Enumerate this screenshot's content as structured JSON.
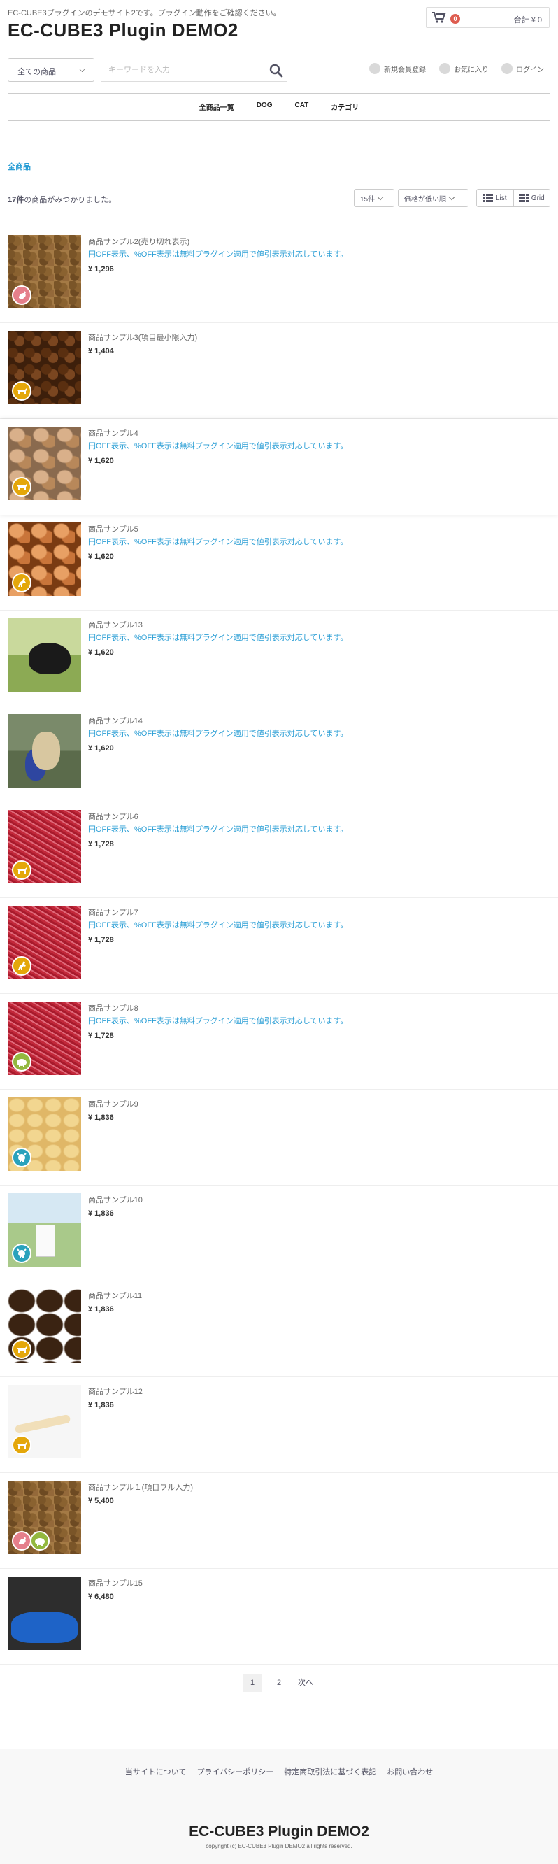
{
  "header": {
    "tagline": "EC-CUBE3プラグインのデモサイト2です。プラグイン動作をご確認ください。",
    "site_title": "EC-CUBE3 Plugin DEMO2",
    "cart": {
      "count": "0",
      "summary": "合計 ¥ 0"
    }
  },
  "search": {
    "category_value": "全ての商品",
    "placeholder": "キーワードを入力"
  },
  "user_nav": {
    "register": "新規会員登録",
    "favorites": "お気に入り",
    "login": "ログイン"
  },
  "category_nav": [
    "全商品一覧",
    "DOG",
    "CAT",
    "カテゴリ"
  ],
  "breadcrumb": "全商品",
  "results": {
    "count": "17件",
    "suffix": "の商品がみつかりました。"
  },
  "controls": {
    "per_page": "15件",
    "sort": "価格が低い順",
    "list_label": "List",
    "grid_label": "Grid"
  },
  "discount_note": "円OFF表示、%OFF表示は無料プラグイン適用で値引表示対応しています。",
  "products": [
    {
      "name": "商品サンプル2(売り切れ表示)",
      "price": "¥ 1,296",
      "note": true,
      "img": "kibble",
      "badges": [
        "chicken-icon"
      ],
      "badge_colors": [
        "#e57f8b"
      ]
    },
    {
      "name": "商品サンプル3(項目最小限入力)",
      "price": "¥ 1,404",
      "note": false,
      "img": "brownkib",
      "badges": [
        "cow-icon"
      ],
      "badge_colors": [
        "#e4a70a"
      ]
    },
    {
      "name": "商品サンプル4",
      "price": "¥ 1,620",
      "note": true,
      "img": "treats",
      "badges": [
        "cow-icon"
      ],
      "badge_colors": [
        "#e4a70a"
      ]
    },
    {
      "name": "商品サンプル5",
      "price": "¥ 1,620",
      "note": true,
      "img": "treats2",
      "badges": [
        "horse-icon"
      ],
      "badge_colors": [
        "#e4a70a"
      ]
    },
    {
      "name": "商品サンプル13",
      "price": "¥ 1,620",
      "note": true,
      "img": "dog1",
      "badges": [],
      "badge_colors": []
    },
    {
      "name": "商品サンプル14",
      "price": "¥ 1,620",
      "note": true,
      "img": "dog2",
      "badges": [],
      "badge_colors": []
    },
    {
      "name": "商品サンプル6",
      "price": "¥ 1,728",
      "note": true,
      "img": "mince",
      "badges": [
        "cow-icon"
      ],
      "badge_colors": [
        "#e4a70a"
      ]
    },
    {
      "name": "商品サンプル7",
      "price": "¥ 1,728",
      "note": true,
      "img": "mince",
      "badges": [
        "horse-icon"
      ],
      "badge_colors": [
        "#e4a70a"
      ]
    },
    {
      "name": "商品サンプル8",
      "price": "¥ 1,728",
      "note": true,
      "img": "mince",
      "badges": [
        "pig-icon"
      ],
      "badge_colors": [
        "#93b83f"
      ]
    },
    {
      "name": "商品サンプル9",
      "price": "¥ 1,836",
      "note": false,
      "img": "cheese",
      "badges": [
        "sheep-icon"
      ],
      "badge_colors": [
        "#2aa2bc"
      ]
    },
    {
      "name": "商品サンプル10",
      "price": "¥ 1,836",
      "note": false,
      "img": "milk",
      "badges": [
        "sheep-icon"
      ],
      "badge_colors": [
        "#2aa2bc"
      ]
    },
    {
      "name": "商品サンプル11",
      "price": "¥ 1,836",
      "note": false,
      "img": "jerky",
      "badges": [
        "cow-icon"
      ],
      "badge_colors": [
        "#e4a70a"
      ]
    },
    {
      "name": "商品サンプル12",
      "price": "¥ 1,836",
      "note": false,
      "img": "bone",
      "badges": [
        "cow-icon"
      ],
      "badge_colors": [
        "#e4a70a"
      ]
    },
    {
      "name": "商品サンプル１(項目フル入力)",
      "price": "¥ 5,400",
      "note": false,
      "img": "kibble",
      "badges": [
        "chicken-icon",
        "pig-icon"
      ],
      "badge_colors": [
        "#e57f8b",
        "#93b83f"
      ]
    },
    {
      "name": "商品サンプル15",
      "price": "¥ 6,480",
      "note": false,
      "img": "bed",
      "badges": [],
      "badge_colors": []
    }
  ],
  "pager": {
    "page1": "1",
    "page2": "2",
    "next": "次へ"
  },
  "footer": {
    "links": [
      "当サイトについて",
      "プライバシーポリシー",
      "特定商取引法に基づく表記",
      "お問い合わせ"
    ],
    "title": "EC-CUBE3 Plugin DEMO2",
    "copyright": "copyright (c) EC-CUBE3 Plugin DEMO2 all rights reserved."
  },
  "colors": {
    "accent": "#2a9ed5",
    "cart_badge": "#de5d50",
    "text": "#525263"
  }
}
